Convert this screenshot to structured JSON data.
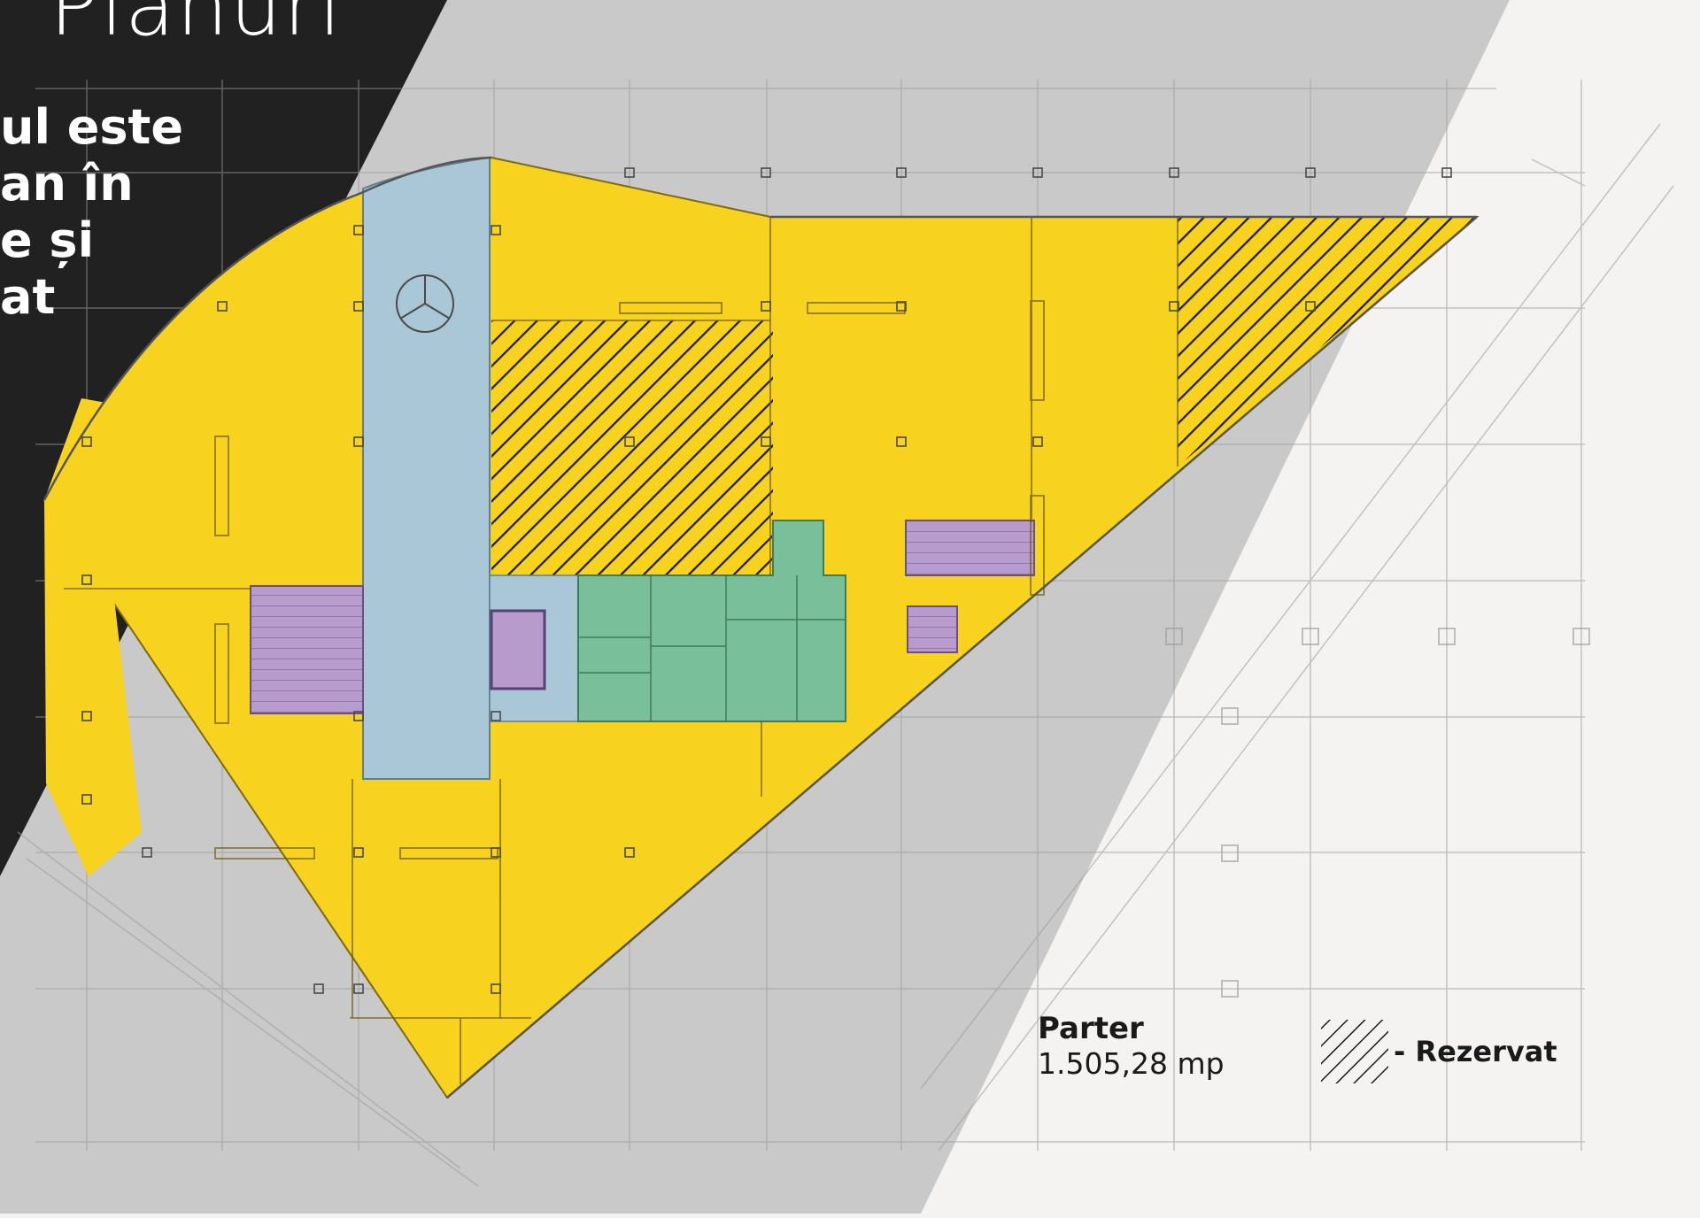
{
  "title": "Planuri",
  "intro_lines": [
    "ul este",
    "an în",
    "e și",
    "at"
  ],
  "legend": {
    "floor_label": "Parter",
    "area": "1.505,28 mp",
    "reserved_label": "- Rezervat"
  },
  "colors": {
    "dark": "#212121",
    "grey": "#c9c9c9",
    "light": "#f4f3f1",
    "office_yellow": "#f7d21e",
    "core_blue": "#a9c7d7",
    "toilets_green": "#78bf9a",
    "stairs_purple": "#b79bcc",
    "hatch": "#1c1c1c",
    "plan_lines": "#6e6e6e"
  }
}
